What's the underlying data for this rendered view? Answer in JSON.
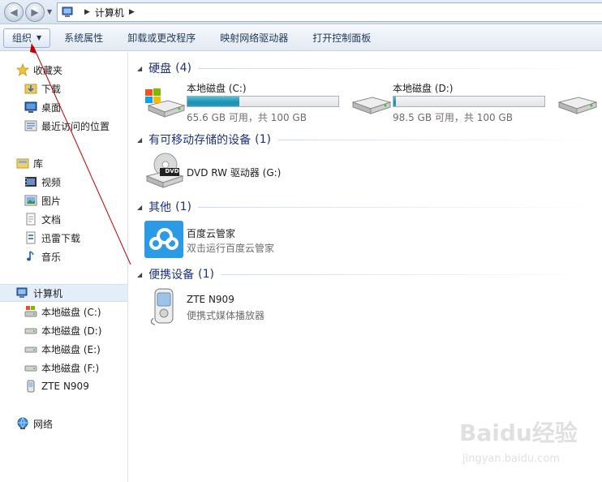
{
  "address": {
    "crumbs": [
      "计算机"
    ]
  },
  "toolbar": {
    "organize_label": "组织",
    "system_properties_label": "系统属性",
    "uninstall_label": "卸载或更改程序",
    "map_drive_label": "映射网络驱动器",
    "control_panel_label": "打开控制面板"
  },
  "sidebar": {
    "favorites": {
      "label": "收藏夹",
      "items": [
        {
          "label": "下载",
          "icon": "download-folder-icon"
        },
        {
          "label": "桌面",
          "icon": "desktop-icon"
        },
        {
          "label": "最近访问的位置",
          "icon": "recent-places-icon"
        }
      ]
    },
    "libraries": {
      "label": "库",
      "items": [
        {
          "label": "视频",
          "icon": "video-icon"
        },
        {
          "label": "图片",
          "icon": "picture-icon"
        },
        {
          "label": "文档",
          "icon": "document-icon"
        },
        {
          "label": "迅雷下载",
          "icon": "thunder-download-icon"
        },
        {
          "label": "音乐",
          "icon": "music-icon"
        }
      ]
    },
    "computer": {
      "label": "计算机",
      "items": [
        {
          "label": "本地磁盘 (C:)",
          "icon": "drive-icon"
        },
        {
          "label": "本地磁盘 (D:)",
          "icon": "drive-icon"
        },
        {
          "label": "本地磁盘 (E:)",
          "icon": "drive-icon"
        },
        {
          "label": "本地磁盘 (F:)",
          "icon": "drive-icon"
        },
        {
          "label": "ZTE N909",
          "icon": "phone-icon"
        }
      ]
    },
    "network": {
      "label": "网络"
    }
  },
  "main": {
    "hard_disks": {
      "title": "硬盘",
      "count": "(4)",
      "drives": [
        {
          "name": "本地磁盘 (C:)",
          "info": "65.6 GB 可用，共 100 GB",
          "used_fraction": 0.344
        },
        {
          "name": "本地磁盘 (D:)",
          "info": "98.5 GB 可用，共 100 GB",
          "used_fraction": 0.015
        }
      ]
    },
    "removable": {
      "title": "有可移动存储的设备",
      "count": "(1)",
      "items": [
        {
          "name": "DVD RW 驱动器 (G:)",
          "icon_text": "DVD"
        }
      ]
    },
    "other": {
      "title": "其他",
      "count": "(1)",
      "items": [
        {
          "name": "百度云管家",
          "desc": "双击运行百度云管家"
        }
      ]
    },
    "portable": {
      "title": "便携设备",
      "count": "(1)",
      "items": [
        {
          "name": "ZTE N909",
          "desc": "便携式媒体播放器"
        }
      ]
    }
  },
  "watermark": {
    "logo": "Baidu经验",
    "url": "jingyan.baidu.com"
  },
  "colors": {
    "group_title": "#1e3287",
    "bar_fill": "#26a0c2",
    "annotation_arrow": "#c00000",
    "nav_selected": "#e4eef9"
  }
}
